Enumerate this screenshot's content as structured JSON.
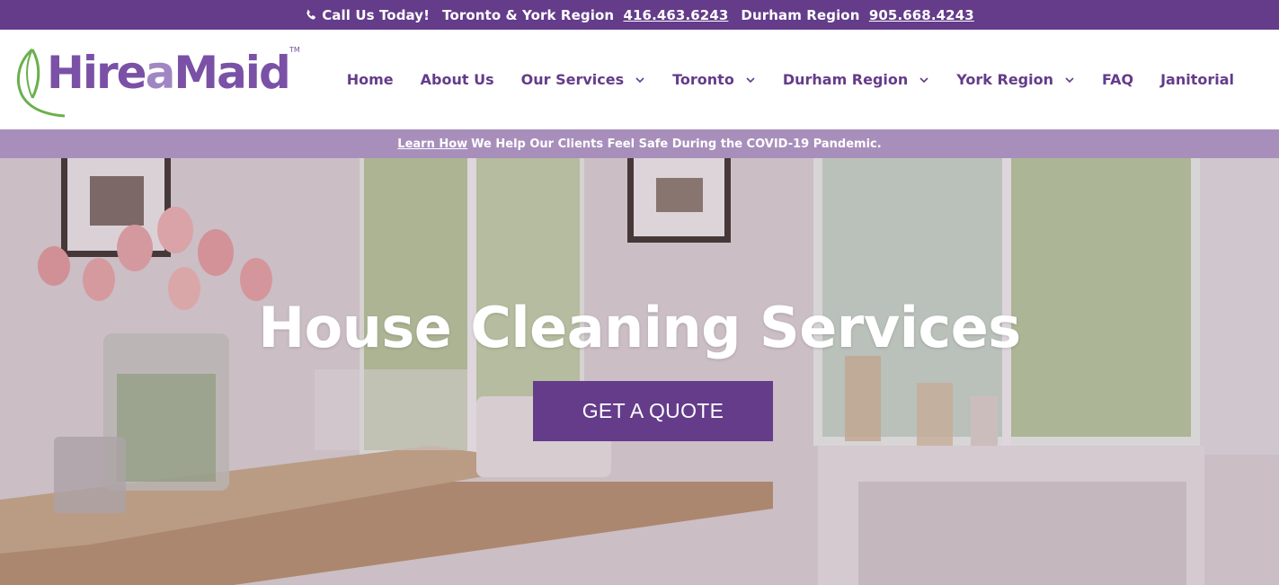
{
  "topbar": {
    "call_label": "Call Us Today!",
    "toronto_label": "Toronto & York Region",
    "toronto_phone": "416.463.6243",
    "durham_label": "Durham Region",
    "durham_phone": "905.668.4243",
    "icon": "phone-icon"
  },
  "logo": {
    "hire": "Hire",
    "a": "a",
    "maid": "Maid",
    "tm": "TM"
  },
  "nav": {
    "items": [
      {
        "label": "Home",
        "dropdown": false
      },
      {
        "label": "About Us",
        "dropdown": false
      },
      {
        "label": "Our Services",
        "dropdown": true
      },
      {
        "label": "Toronto",
        "dropdown": true
      },
      {
        "label": "Durham Region",
        "dropdown": true
      },
      {
        "label": "York Region",
        "dropdown": true
      },
      {
        "label": "FAQ",
        "dropdown": false
      },
      {
        "label": "Janitorial",
        "dropdown": false
      }
    ]
  },
  "covid": {
    "link": "Learn How",
    "text": "We Help Our Clients Feel Safe During the COVID-19 Pandemic."
  },
  "hero": {
    "title": "House Cleaning Services",
    "button": "GET A QUOTE"
  },
  "colors": {
    "brand_purple": "#643c8a",
    "light_purple": "#a88fbb",
    "leaf_green": "#6ab04c"
  }
}
